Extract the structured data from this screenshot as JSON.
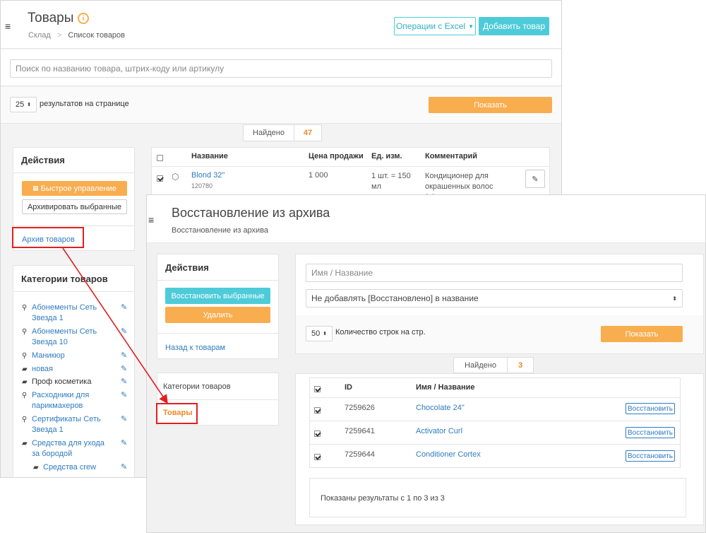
{
  "back_window": {
    "title": "Товары",
    "breadcrumb": {
      "root": "Склад",
      "separator": ">",
      "current": "Список товаров"
    },
    "excel_button": "Операции с Excel",
    "add_button": "Добавить товар",
    "search_placeholder": "Поиск по названию товара, штрих-коду или артикулу",
    "per_page_value": "25",
    "per_page_label": "результатов на странице",
    "show_button": "Показать",
    "found_label": "Найдено",
    "found_count": "47",
    "actions_title": "Действия",
    "quick_manage_button": "Быстрое управление",
    "archive_selected_button": "Архивировать выбранные",
    "archive_link": "Архив товаров",
    "categories_title": "Категории товаров",
    "categories": [
      {
        "label": "Абонементы Сеть Звезда 1",
        "icon": "link-icon"
      },
      {
        "label": "Абонементы Сеть Звезда 10",
        "icon": "link-icon"
      },
      {
        "label": "Маникюр",
        "icon": "link-icon"
      },
      {
        "label": "новая",
        "icon": "folder-icon"
      },
      {
        "label": "Проф косметика",
        "icon": "folder-icon"
      },
      {
        "label": "Расходники для парикмахеров",
        "icon": "link-icon"
      },
      {
        "label": "Сертификаты Сеть Звезда 1",
        "icon": "link-icon"
      },
      {
        "label": "Средства для ухода за бородой",
        "icon": "folder-icon"
      },
      {
        "label": "Средства crew",
        "icon": "folder-icon"
      }
    ],
    "table_headers": {
      "name": "Название",
      "price": "Цена продажи",
      "unit": "Ед. изм.",
      "comment": "Комментарий"
    },
    "table_row": {
      "name": "Blond 32\"",
      "code": "120780",
      "price": "1 000",
      "unit": "1 шт. = 150 мл",
      "comment": "Кондиционер для окрашенных волос (тёплые оттенки блонда)"
    }
  },
  "front_window": {
    "title": "Восстановление из архива",
    "subtitle": "Восстановление из архива",
    "actions_title": "Действия",
    "restore_selected_button": "Восстановить выбранные",
    "delete_button": "Удалить",
    "back_link": "Назад к товарам",
    "categories_title": "Категории товаров",
    "categories_active": "Товары",
    "name_placeholder": "Имя / Название",
    "suffix_select": "Не добавлять [Восстановлено] в название",
    "rows_value": "50",
    "rows_label": "Количество строк на стр.",
    "show_button": "Показать",
    "found_label": "Найдено",
    "found_count": "3",
    "table_headers": {
      "id": "ID",
      "name": "Имя / Название"
    },
    "rows": [
      {
        "id": "7259626",
        "name": "Chocolate 24\"",
        "action": "Восстановить"
      },
      {
        "id": "7259641",
        "name": "Activator Curl",
        "action": "Восстановить"
      },
      {
        "id": "7259644",
        "name": "Conditioner Cortex",
        "action": "Восстановить"
      }
    ],
    "pagination_text": "Показаны результаты с 1 по 3 из 3"
  },
  "colors": {
    "accent_orange": "#f8ad4f",
    "accent_cyan": "#4ecbd9",
    "link_blue": "#2f7bbf",
    "highlight_red": "#e02020"
  }
}
